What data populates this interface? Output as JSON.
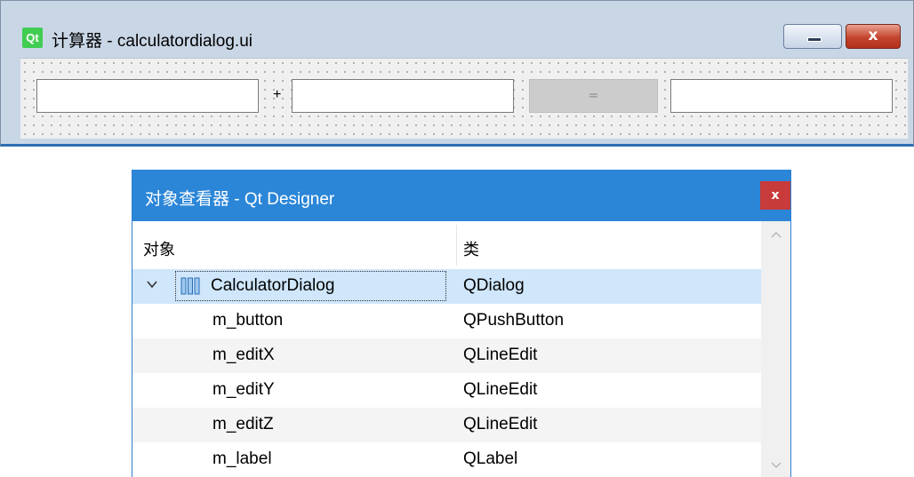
{
  "form_window": {
    "logo": "Qt",
    "title": "计算器 - calculatordialog.ui",
    "close_glyph": "x",
    "plus_label": "+",
    "equals_label": "="
  },
  "inspector": {
    "title": "对象查看器 - Qt Designer",
    "close_glyph": "x",
    "headers": {
      "object": "对象",
      "class": "类"
    },
    "root": {
      "object": "CalculatorDialog",
      "class": "QDialog"
    },
    "children": [
      {
        "object": "m_button",
        "class": "QPushButton"
      },
      {
        "object": "m_editX",
        "class": "QLineEdit"
      },
      {
        "object": "m_editY",
        "class": "QLineEdit"
      },
      {
        "object": "m_editZ",
        "class": "QLineEdit"
      },
      {
        "object": "m_label",
        "class": "QLabel"
      }
    ]
  },
  "icons": {
    "qt_logo": "qt-logo-icon",
    "minimize": "minimize-icon",
    "close": "close-icon",
    "expand": "chevron-down-icon",
    "dialog": "dialog-layout-icon",
    "scroll_up": "scroll-up-icon",
    "scroll_down": "scroll-down-icon"
  },
  "colors": {
    "qt_green": "#41cd52",
    "inspector_titlebar": "#2b86d8",
    "selection": "#cfe6fb",
    "close_red": "#c73b3b"
  }
}
